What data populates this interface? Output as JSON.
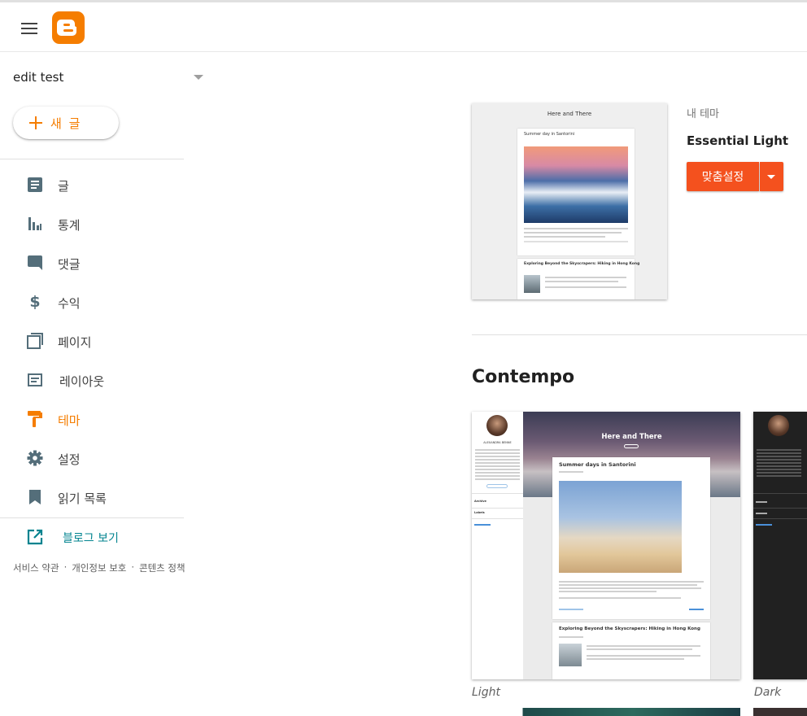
{
  "header": {
    "menu_icon": "hamburger-icon",
    "logo_icon": "blogger-logo"
  },
  "blog_selector": {
    "name": "edit test",
    "icon": "dropdown-caret-icon"
  },
  "new_post": {
    "label": "새 글",
    "icon": "plus-icon"
  },
  "nav": {
    "posts": {
      "label": "글",
      "icon": "posts-icon"
    },
    "stats": {
      "label": "통계",
      "icon": "stats-icon"
    },
    "comments": {
      "label": "댓글",
      "icon": "comment-icon"
    },
    "earnings": {
      "label": "수익",
      "icon": "dollar-icon"
    },
    "pages": {
      "label": "페이지",
      "icon": "pages-icon"
    },
    "layout": {
      "label": "레이아웃",
      "icon": "layout-icon"
    },
    "theme": {
      "label": "테마",
      "icon": "paint-roller-icon",
      "active": true
    },
    "settings": {
      "label": "설정",
      "icon": "gear-icon"
    },
    "reading_list": {
      "label": "읽기 목록",
      "icon": "bookmark-icon"
    }
  },
  "view_blog": {
    "label": "블로그 보기",
    "icon": "open-external-icon"
  },
  "footer": {
    "terms": "서비스 약관",
    "privacy": "개인정보 보호",
    "content_policy": "콘텐츠 정책",
    "separator": "·"
  },
  "my_theme": {
    "label": "내 테마",
    "name": "Essential Light",
    "customize": "맞춤설정",
    "preview": {
      "blog_title": "Here and There",
      "post1_title": "Summer day in Santorini",
      "post2_title": "Exploring Beyond the Skyscrapers: Hiking in Hong Kong"
    }
  },
  "section": {
    "title": "Contempo",
    "variants": [
      {
        "label": "Light",
        "preview": {
          "blog_title": "Here and There",
          "author": "ALEXANDRA BENNE",
          "post1_title": "Summer days in Santorini",
          "post2_title": "Exploring Beyond the Skyscrapers: Hiking in Hong Kong",
          "sidebar_items": [
            "Archive",
            "Labels"
          ]
        }
      },
      {
        "label": "Dark"
      }
    ]
  },
  "colors": {
    "accent": "#f57d00",
    "button": "#f4511e",
    "view_blog": "#00838f",
    "icon_grey": "#546e7a"
  }
}
